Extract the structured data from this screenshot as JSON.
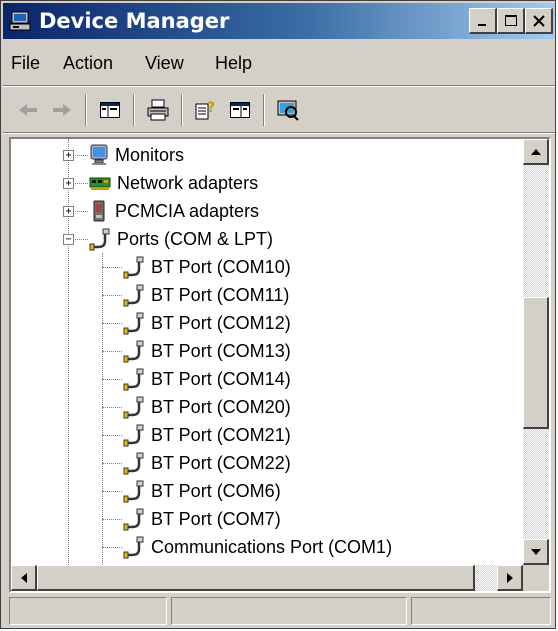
{
  "window": {
    "title": "Device Manager"
  },
  "menu": {
    "items": [
      "File",
      "Action",
      "View",
      "Help"
    ]
  },
  "toolbar": {
    "buttons": [
      "back-icon",
      "forward-icon",
      "show-hide-console-tree-icon",
      "print-icon",
      "help-icon",
      "properties-icon",
      "scan-hardware-icon"
    ]
  },
  "tree": {
    "categories": [
      {
        "label": "Monitors",
        "icon": "monitor-icon",
        "expanded": false
      },
      {
        "label": "Network adapters",
        "icon": "network-adapter-icon",
        "expanded": false
      },
      {
        "label": "PCMCIA adapters",
        "icon": "pcmcia-icon",
        "expanded": false
      },
      {
        "label": "Ports (COM & LPT)",
        "icon": "port-icon",
        "expanded": true
      }
    ],
    "ports": [
      "BT Port (COM10)",
      "BT Port (COM11)",
      "BT Port (COM12)",
      "BT Port (COM13)",
      "BT Port (COM14)",
      "BT Port (COM20)",
      "BT Port (COM21)",
      "BT Port (COM22)",
      "BT Port (COM6)",
      "BT Port (COM7)",
      "Communications Port (COM1)"
    ]
  },
  "status": {
    "panes": [
      "",
      "",
      ""
    ]
  },
  "colors": {
    "titlebar_start": "#0a246a",
    "titlebar_end": "#a6caf0",
    "face": "#d4d0c8"
  }
}
